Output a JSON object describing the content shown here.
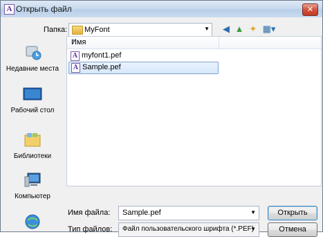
{
  "window": {
    "title": "Открыть файл",
    "app_icon_letter": "A",
    "close_label": "✕"
  },
  "toolbar": {
    "folder_label": "Папка:",
    "folder_value": "MyFont"
  },
  "places": [
    {
      "label": "Недавние места",
      "icon": "recent-places-icon"
    },
    {
      "label": "Рабочий стол",
      "icon": "desktop-icon"
    },
    {
      "label": "Библиотеки",
      "icon": "libraries-icon"
    },
    {
      "label": "Компьютер",
      "icon": "computer-icon"
    },
    {
      "label": "",
      "icon": "network-icon"
    }
  ],
  "file_list": {
    "header_name": "Имя",
    "files": [
      {
        "name": "myfont1.pef",
        "selected": false
      },
      {
        "name": "Sample.pef",
        "selected": true
      }
    ]
  },
  "form": {
    "filename_label": "Имя файла:",
    "filename_value": "Sample.pef",
    "filetype_label": "Тип файлов:",
    "filetype_value": "Файл пользовательского шрифта (*.PEF)",
    "open_label": "Открыть",
    "cancel_label": "Отмена"
  },
  "colors": {
    "accent": "#3c7fb1",
    "selection": "#d6e8fb",
    "close": "#c13a22"
  }
}
